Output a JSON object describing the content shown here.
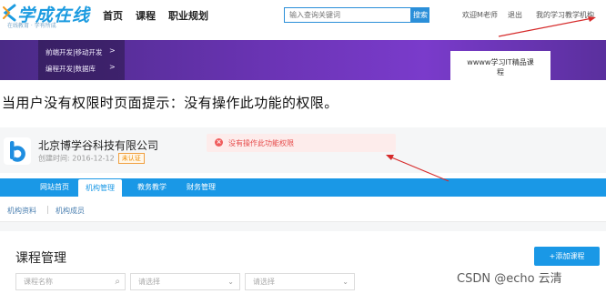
{
  "header": {
    "logo_text": "学成在线",
    "logo_slogan": "在线教育 · 学有所成",
    "nav": [
      "首页",
      "课程",
      "职业规划"
    ],
    "search_placeholder": "输入查询关键词",
    "search_button": "搜索",
    "user_links": [
      "欢迎M老师",
      "退出",
      "我的学习",
      "教学机构"
    ]
  },
  "banner": {
    "menu_items": [
      "前端开发|移动开发",
      "编程开发|数据库"
    ],
    "card_text_line1": "wwww学习IT精品课",
    "card_text_line2": "程"
  },
  "caption": "当用户没有权限时页面提示：没有操作此功能的权限。",
  "admin": {
    "org_name": "北京博学谷科技有限公司",
    "created_label": "创建时间:  2016-12-12",
    "badge": "未认证",
    "alert_text": "没有操作此功能权限",
    "tabs": [
      "网站首页",
      "机构管理",
      "教务教学",
      "财务管理"
    ],
    "active_tab": "机构管理",
    "subtabs": [
      "机构资料",
      "机构成员"
    ],
    "section_title": "课程管理",
    "add_button": "+添加课程",
    "filters": [
      {
        "placeholder": "课程名称"
      },
      {
        "placeholder": "请选择"
      },
      {
        "placeholder": "请选择"
      }
    ]
  },
  "watermark": "CSDN @echo 云清",
  "colors": {
    "brand_blue": "#1a98e6",
    "banner_purple": "#6b34b5",
    "alert_red": "#e64a4a",
    "annotation_red": "#d62b2b"
  }
}
